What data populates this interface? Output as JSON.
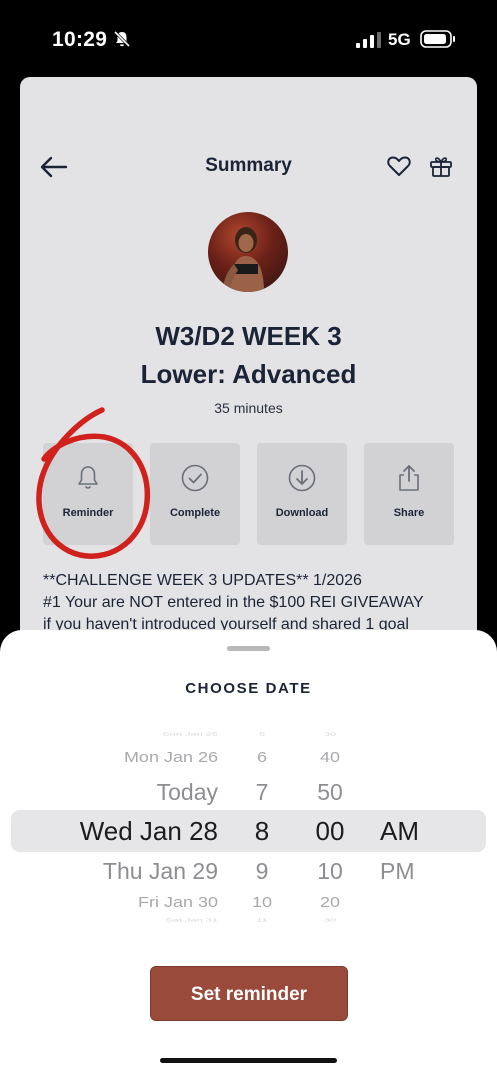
{
  "status_bar": {
    "time": "10:29",
    "network": "5G"
  },
  "header": {
    "title": "Summary"
  },
  "workout": {
    "title": "W3/D2 WEEK 3",
    "subtitle": "Lower: Advanced",
    "duration": "35 minutes"
  },
  "actions": [
    {
      "label": "Reminder",
      "icon": "bell-icon"
    },
    {
      "label": "Complete",
      "icon": "check-circle-icon"
    },
    {
      "label": "Download",
      "icon": "download-icon"
    },
    {
      "label": "Share",
      "icon": "share-icon"
    }
  ],
  "description": {
    "line1": "**CHALLENGE WEEK 3 UPDATES** 1/2026",
    "line2": "#1 Your are NOT entered in the $100 REI GIVEAWAY",
    "line3": "if you haven't introduced yourself and shared 1 goal"
  },
  "sheet": {
    "title": "CHOOSE DATE",
    "picker": {
      "dates": [
        "Sun Jan 25",
        "Mon Jan 26",
        "Today",
        "Wed Jan 28",
        "Thu Jan 29",
        "Fri Jan 30",
        "Sat Jan 31"
      ],
      "hours": [
        "5",
        "6",
        "7",
        "8",
        "9",
        "10",
        "11"
      ],
      "minutes": [
        "30",
        "40",
        "50",
        "00",
        "10",
        "20",
        "30"
      ],
      "ampm": [
        "",
        "",
        "",
        "AM",
        "PM",
        "",
        ""
      ],
      "selected_date": "Wed Jan 28",
      "selected_hour": "8",
      "selected_minute": "00",
      "selected_period": "AM"
    },
    "button_label": "Set reminder"
  },
  "colors": {
    "accent": "#9a4a3a",
    "annotation": "#d0211c",
    "text": "#1b2437"
  }
}
